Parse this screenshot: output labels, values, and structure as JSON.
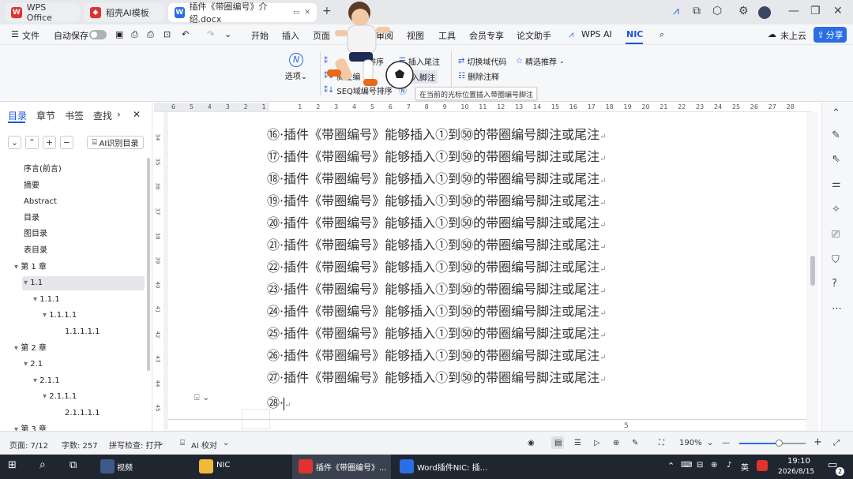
{
  "tabs": [
    {
      "label": "WPS Office",
      "icon": "wps-icon"
    },
    {
      "label": "稻壳AI模板",
      "icon": "daoke-icon"
    },
    {
      "label": "插件《带圈编号》介绍.docx",
      "icon": "word-doc-icon",
      "active": true
    }
  ],
  "menu": {
    "file": "文件",
    "autosave": "自动保存",
    "items": [
      "开始",
      "插入",
      "页面",
      "审阅",
      "视图",
      "工具",
      "会员专享",
      "论文助手",
      "WPS AI",
      "NIC"
    ],
    "cloud": "未上云",
    "share": "分享"
  },
  "ribbon": {
    "select": "选项",
    "b1": "排序",
    "b2": "插入尾注",
    "b3": "切换域代码",
    "b4": "精选推荐",
    "b5": "脚注编",
    "b6": "序",
    "b7": "插入脚注",
    "b8": "删除注释",
    "b9": "SEQ域编号排序",
    "tooltip": "在当前的光标位置插入带圈编号脚注"
  },
  "nav": {
    "tabs": [
      "目录",
      "章节",
      "书签",
      "查找"
    ],
    "ai_toc": "AI识别目录",
    "toc": [
      {
        "label": "序言(前言)",
        "level": 0
      },
      {
        "label": "摘要",
        "level": 0
      },
      {
        "label": "Abstract",
        "level": 0
      },
      {
        "label": "目录",
        "level": 0
      },
      {
        "label": "图目录",
        "level": 0
      },
      {
        "label": "表目录",
        "level": 0
      },
      {
        "label": "第 1 章",
        "level": 0,
        "arrow": true
      },
      {
        "label": "1.1",
        "level": 1,
        "arrow": true,
        "selected": true
      },
      {
        "label": "1.1.1",
        "level": 2,
        "arrow": true
      },
      {
        "label": "1.1.1.1",
        "level": 3,
        "arrow": true
      },
      {
        "label": "1.1.1.1.1",
        "level": 4
      },
      {
        "label": "第 2 章",
        "level": 0,
        "arrow": true
      },
      {
        "label": "2.1",
        "level": 1,
        "arrow": true
      },
      {
        "label": "2.1.1",
        "level": 2,
        "arrow": true
      },
      {
        "label": "2.1.1.1",
        "level": 3,
        "arrow": true
      },
      {
        "label": "2.1.1.1.1",
        "level": 4
      },
      {
        "label": "第 3 章",
        "level": 0,
        "arrow": true
      }
    ]
  },
  "ruler": {
    "h_marks": [
      "6",
      "5",
      "4",
      "3",
      "2",
      "1",
      "",
      "1",
      "2",
      "3",
      "4",
      "5",
      "6",
      "7",
      "8",
      "9",
      "10",
      "11",
      "12",
      "13",
      "14",
      "15",
      "16",
      "17",
      "18",
      "19",
      "20",
      "21",
      "22",
      "23",
      "24",
      "25",
      "26",
      "27",
      "28"
    ],
    "v_marks": [
      "34",
      "35",
      "36",
      "37",
      "38",
      "39",
      "40",
      "41",
      "42",
      "43",
      "44",
      "45"
    ]
  },
  "document": {
    "lines": [
      {
        "num": "⑯",
        "text": "·插件《带圈编号》能够插入①到㊿的带圈编号脚注或尾注"
      },
      {
        "num": "⑰",
        "text": "·插件《带圈编号》能够插入①到㊿的带圈编号脚注或尾注"
      },
      {
        "num": "⑱",
        "text": "·插件《带圈编号》能够插入①到㊿的带圈编号脚注或尾注"
      },
      {
        "num": "⑲",
        "text": "·插件《带圈编号》能够插入①到㊿的带圈编号脚注或尾注"
      },
      {
        "num": "⑳",
        "text": "·插件《带圈编号》能够插入①到㊿的带圈编号脚注或尾注"
      },
      {
        "num": "㉑",
        "text": "·插件《带圈编号》能够插入①到㊿的带圈编号脚注或尾注"
      },
      {
        "num": "㉒",
        "text": "·插件《带圈编号》能够插入①到㊿的带圈编号脚注或尾注"
      },
      {
        "num": "㉓",
        "text": "·插件《带圈编号》能够插入①到㊿的带圈编号脚注或尾注"
      },
      {
        "num": "㉔",
        "text": "·插件《带圈编号》能够插入①到㊿的带圈编号脚注或尾注"
      },
      {
        "num": "㉕",
        "text": "·插件《带圈编号》能够插入①到㊿的带圈编号脚注或尾注"
      },
      {
        "num": "㉖",
        "text": "·插件《带圈编号》能够插入①到㊿的带圈编号脚注或尾注"
      },
      {
        "num": "㉗",
        "text": "·插件《带圈编号》能够插入①到㊿的带圈编号脚注或尾注"
      }
    ],
    "last_num": "㉘",
    "last_text": "·",
    "para_mark": "↵",
    "page_num": "5"
  },
  "status": {
    "page": "页面: 7/12",
    "words": "字数: 257",
    "spell": "拼写检查: 打开",
    "ai_check": "AI 校对",
    "zoom": "190%"
  },
  "taskbar": {
    "items": [
      "视频",
      "NIC",
      "插件《带圈编号》...",
      "Word插件NIC: 插..."
    ],
    "time": "19:10",
    "date": "2026/8/15",
    "ime": "英",
    "notif": "2"
  },
  "colors": {
    "accent": "#1a56db",
    "share_bg": "#2b6de5",
    "wps_red": "#e0322f"
  }
}
